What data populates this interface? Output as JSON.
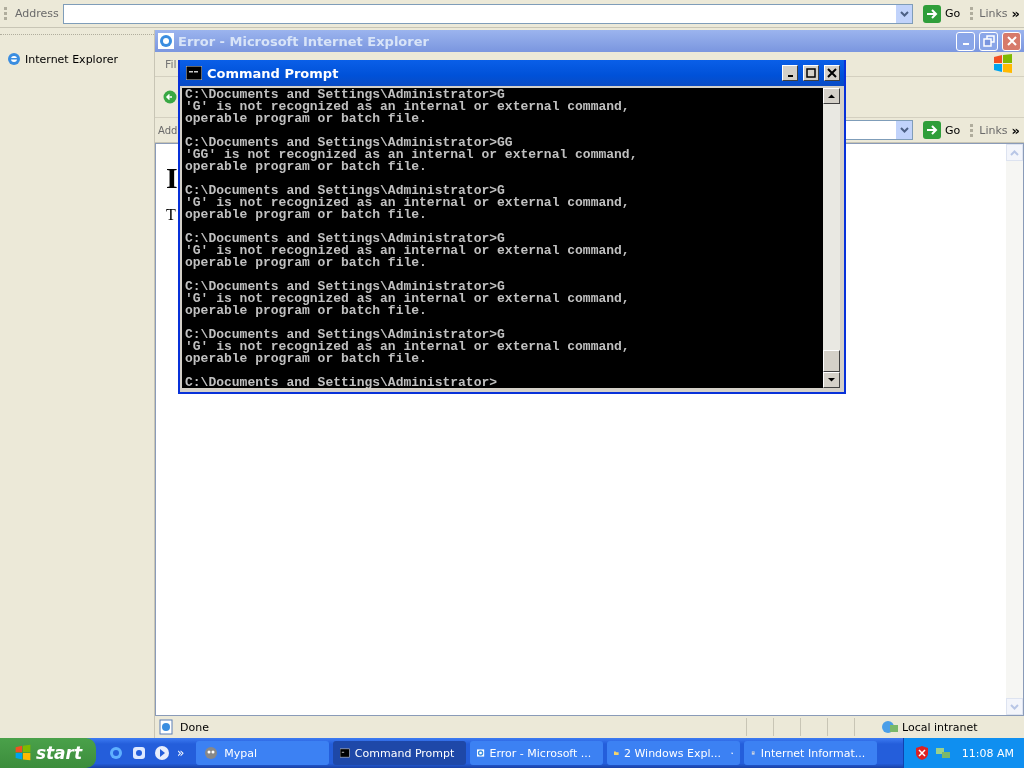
{
  "explorer": {
    "address_label": "Address",
    "go": "Go",
    "links": "Links",
    "chevron": "»",
    "sidebar_item": "Internet Explorer"
  },
  "ie_window": {
    "title": "Error - Microsoft Internet Explorer",
    "menu_partial": "Fil",
    "address_label_partial": "Add",
    "go": "Go",
    "links": "Links",
    "chevron": "»",
    "heading_partial": "I",
    "text_partial": "T",
    "status": "Done",
    "zone": "Local intranet"
  },
  "cmd_window": {
    "title": "Command Prompt",
    "blocks": [
      {
        "lines": [
          "C:\\Documents and Settings\\Administrator>G",
          "'G' is not recognized as an internal or external command,",
          "operable program or batch file."
        ]
      },
      {
        "lines": [
          "C:\\Documents and Settings\\Administrator>GG",
          "'GG' is not recognized as an internal or external command,",
          "operable program or batch file."
        ]
      },
      {
        "lines": [
          "C:\\Documents and Settings\\Administrator>G",
          "'G' is not recognized as an internal or external command,",
          "operable program or batch file."
        ]
      },
      {
        "lines": [
          "C:\\Documents and Settings\\Administrator>G",
          "'G' is not recognized as an internal or external command,",
          "operable program or batch file."
        ]
      },
      {
        "lines": [
          "C:\\Documents and Settings\\Administrator>G",
          "'G' is not recognized as an internal or external command,",
          "operable program or batch file."
        ]
      },
      {
        "lines": [
          "C:\\Documents and Settings\\Administrator>G",
          "'G' is not recognized as an internal or external command,",
          "operable program or batch file."
        ]
      },
      {
        "lines": [
          "C:\\Documents and Settings\\Administrator>"
        ]
      }
    ]
  },
  "taskbar": {
    "start": "start",
    "quick_launch_more": "»",
    "tasks": [
      {
        "kind": "app",
        "label": "Mypal",
        "selected": false,
        "grouped": false
      },
      {
        "kind": "console",
        "label": "Command Prompt",
        "selected": true,
        "grouped": false
      },
      {
        "kind": "ie",
        "label": "Error - Microsoft ...",
        "selected": false,
        "grouped": false
      },
      {
        "kind": "folder",
        "label": "2 Windows Expl...",
        "selected": false,
        "grouped": true
      },
      {
        "kind": "iis",
        "label": "Internet Informat...",
        "selected": false,
        "grouped": false
      }
    ],
    "clock": "11:08 AM"
  }
}
